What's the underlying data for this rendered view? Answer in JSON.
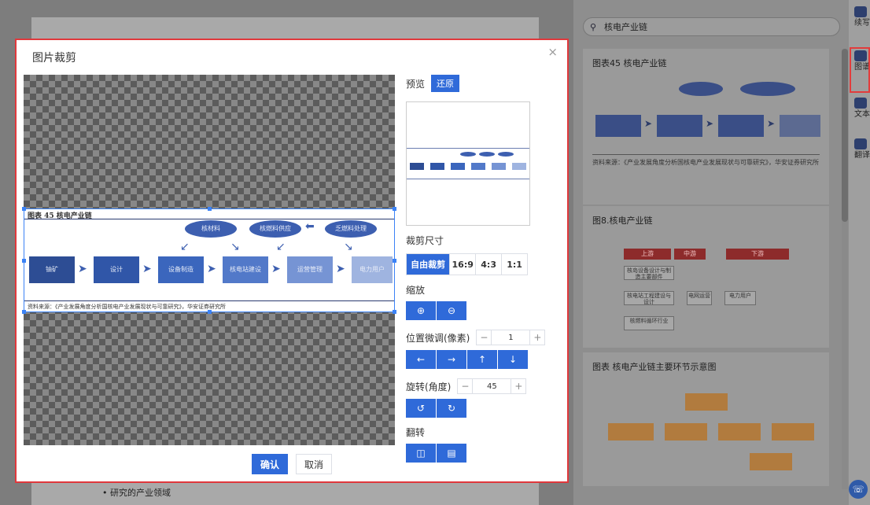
{
  "background": {
    "doc_bullet": "• 研究的产业领域",
    "search_value": "核电产业链",
    "cards": [
      {
        "title": "图表45 核电产业链",
        "note": "资料来源：《产业发展角度分析国核电产业发展现状与可靠研究》，华安证券研究所"
      },
      {
        "title": "图8.核电产业链",
        "tags": [
          "上游",
          "中游",
          "下游"
        ],
        "boxes": [
          "核岛设备设计与制造主要部件",
          "核电站工程建设与设计",
          "电网运营",
          "电力用户",
          "核燃料循环行业"
        ]
      },
      {
        "title": "图表 核电产业链主要环节示意图"
      }
    ],
    "rail": [
      {
        "label": "续写"
      },
      {
        "label": "图谱"
      },
      {
        "label": "文本"
      },
      {
        "label": "翻译"
      }
    ]
  },
  "dialog": {
    "title": "图片裁剪",
    "close": "×",
    "image": {
      "title": "图表 45 核电产业链",
      "boxes": [
        "铀矿",
        "设计",
        "设备制造",
        "核电站建设",
        "运营管理",
        "电力用户"
      ],
      "ovals": [
        "核材料",
        "核燃料供应",
        "乏燃料处理"
      ],
      "source": "资料来源：《产业发展角度分析国核电产业发展现状与可靠研究》，华安证券研究所"
    },
    "panel": {
      "preview_label": "预览",
      "restore_label": "还原",
      "crop_size_label": "裁剪尺寸",
      "ratios": [
        "自由裁剪",
        "16:9",
        "4:3",
        "1:1"
      ],
      "zoom_label": "缩放",
      "position_label": "位置微调(像素)",
      "position_value": "1",
      "rotate_label": "旋转(角度)",
      "rotate_value": "45",
      "flip_label": "翻转"
    },
    "confirm": "确认",
    "cancel": "取消"
  },
  "colors": {
    "accent": "#2f6ad9",
    "highlight": "#e0383c"
  }
}
